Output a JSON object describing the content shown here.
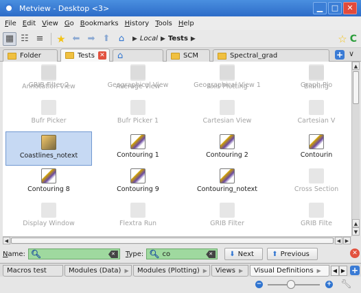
{
  "window": {
    "title": "Metview - Desktop <3>"
  },
  "menu": [
    "File",
    "Edit",
    "View",
    "Go",
    "Bookmarks",
    "History",
    "Tools",
    "Help"
  ],
  "breadcrumb": {
    "root": "Local",
    "current": "Tests"
  },
  "tabs": [
    {
      "label": "Folder",
      "icon": "folder-icon"
    },
    {
      "label": "Tests",
      "icon": "folder-icon",
      "active": true
    },
    {
      "label": "",
      "icon": "home-icon"
    },
    {
      "label": "SCM",
      "icon": "folder-icon"
    },
    {
      "label": "Spectral_grad",
      "icon": "folder-icon"
    }
  ],
  "icons": [
    {
      "label": "Annotation View",
      "dim": true,
      "kind": "plain"
    },
    {
      "label": "Average View",
      "dim": true,
      "kind": "plain"
    },
    {
      "label": "Axis Plotting",
      "dim": true,
      "kind": "plain"
    },
    {
      "label": "Binning",
      "dim": true,
      "kind": "plain"
    },
    {
      "label": "Bufr Picker",
      "dim": true,
      "kind": "plain"
    },
    {
      "label": "Bufr Picker 1",
      "dim": true,
      "kind": "plain"
    },
    {
      "label": "Cartesian View",
      "dim": true,
      "kind": "plain"
    },
    {
      "label": "Cartesian V",
      "dim": true,
      "kind": "plain"
    },
    {
      "label": "Coastlines_notext",
      "dim": false,
      "kind": "coast",
      "selected": true
    },
    {
      "label": "Contouring 1",
      "dim": false,
      "kind": "contour"
    },
    {
      "label": "Contouring 2",
      "dim": false,
      "kind": "contour"
    },
    {
      "label": "Contourin",
      "dim": false,
      "kind": "contour"
    },
    {
      "label": "Contouring 8",
      "dim": false,
      "kind": "contour"
    },
    {
      "label": "Contouring 9",
      "dim": false,
      "kind": "contour"
    },
    {
      "label": "Contouring_notext",
      "dim": false,
      "kind": "contour"
    },
    {
      "label": "Cross Section",
      "dim": true,
      "kind": "plain"
    },
    {
      "label": "Display Window",
      "dim": true,
      "kind": "plain"
    },
    {
      "label": "Flextra Run",
      "dim": true,
      "kind": "plain"
    },
    {
      "label": "GRIB Filter",
      "dim": true,
      "kind": "plain"
    },
    {
      "label": "GRIB Filte",
      "dim": true,
      "kind": "plain"
    },
    {
      "label": "GRIB Filter 2",
      "dim": true,
      "kind": "plain"
    },
    {
      "label": "Geographical View",
      "dim": true,
      "kind": "plain"
    },
    {
      "label": "Geographical View 1",
      "dim": true,
      "kind": "plain"
    },
    {
      "label": "Graph Plo",
      "dim": true,
      "kind": "plain"
    }
  ],
  "find": {
    "name_label": "Name:",
    "name_value": "",
    "type_label": "Type:",
    "type_value": "co",
    "next_label": "Next",
    "previous_label": "Previous"
  },
  "bottom_tabs": [
    {
      "label": "Macros test"
    },
    {
      "label": "Modules (Data)"
    },
    {
      "label": "Modules (Plotting)"
    },
    {
      "label": "Views"
    },
    {
      "label": "Visual Definitions",
      "active": true
    }
  ],
  "zoom": {
    "level_fraction": 0.45
  }
}
